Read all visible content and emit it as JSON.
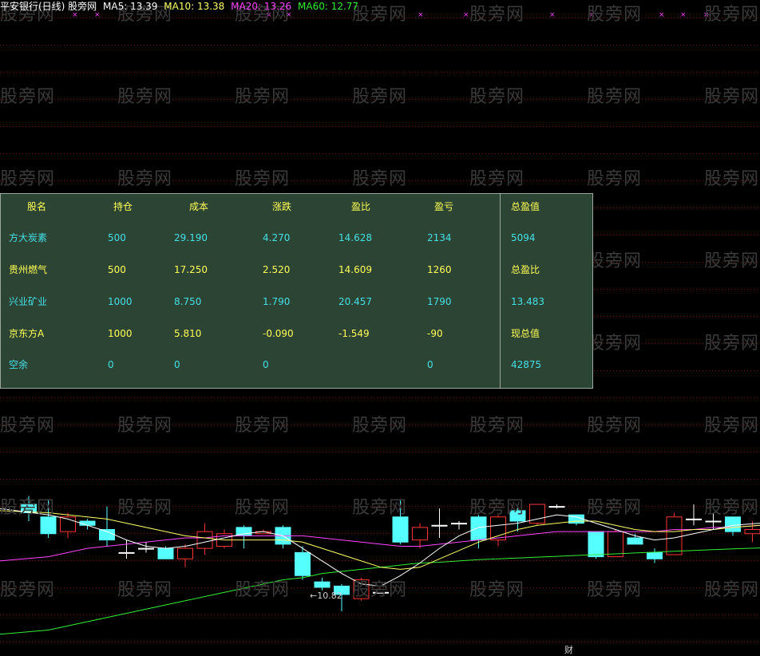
{
  "header": {
    "name": "平安银行(日线) 股旁网",
    "ma5": "MA5: 13.39",
    "ma10": "MA10: 13.38",
    "ma20": "MA20: 13.26",
    "ma60": "MA60: 12.77",
    "colors": {
      "name": "#ffffff",
      "ma5": "#ffffff",
      "ma10": "#ffff66",
      "ma20": "#ff44ff",
      "ma60": "#33ee33"
    }
  },
  "watermark": "股旁网",
  "table": {
    "headers": [
      "股名",
      "持仓",
      "成本",
      "涨跌",
      "盈比",
      "盈亏"
    ],
    "rows": [
      {
        "name": "方大炭素",
        "position": "500",
        "cost": "29.190",
        "change": "4.270",
        "ratio": "14.628",
        "pnl": "2134",
        "color": "#44e0e6"
      },
      {
        "name": "贵州燃气",
        "position": "500",
        "cost": "17.250",
        "change": "2.520",
        "ratio": "14.609",
        "pnl": "1260",
        "color": "#ffff55"
      },
      {
        "name": "兴业矿业",
        "position": "1000",
        "cost": "8.750",
        "change": "1.790",
        "ratio": "20.457",
        "pnl": "1790",
        "color": "#44e0e6"
      },
      {
        "name": "京东方A",
        "position": "1000",
        "cost": "5.810",
        "change": "-0.090",
        "ratio": "-1.549",
        "pnl": "-90",
        "color": "#ffff55"
      },
      {
        "name": "空余",
        "position": "0",
        "cost": "0",
        "change": "0",
        "ratio": "",
        "pnl": "0",
        "color": "#44e0e6"
      }
    ],
    "summary": [
      {
        "text": "总盈值",
        "color": "#ffff55"
      },
      {
        "text": "5094",
        "color": "#44e0e6"
      },
      {
        "text": "总盈比",
        "color": "#ffff55"
      },
      {
        "text": "13.483",
        "color": "#44e0e6"
      },
      {
        "text": "现总值",
        "color": "#ffff55"
      },
      {
        "text": "42875",
        "color": "#44e0e6"
      }
    ],
    "header_color": "#ffff55"
  },
  "chart_data": {
    "type": "candlestick",
    "title": "平安银行(日线)",
    "low_label": "10.82",
    "bottom_label": "财",
    "ylim": [
      10.4,
      14.4
    ],
    "up_color": "#ff3333",
    "down_color": "#55ffff",
    "ma_colors": {
      "ma5": "#ffffff",
      "ma10": "#ffff66",
      "ma20": "#ff44ff",
      "ma60": "#33ee33"
    },
    "candles": [
      [
        13.6,
        13.4,
        13.8,
        13.2
      ],
      [
        13.3,
        12.9,
        13.7,
        12.8
      ],
      [
        12.95,
        13.3,
        13.4,
        12.8
      ],
      [
        13.2,
        13.1,
        13.25,
        13.0
      ],
      [
        13.0,
        12.75,
        13.55,
        12.6
      ],
      [
        12.45,
        12.45,
        12.75,
        12.3
      ],
      [
        12.55,
        12.55,
        12.7,
        12.45
      ],
      [
        12.55,
        12.3,
        12.6,
        12.3
      ],
      [
        12.3,
        12.55,
        12.65,
        12.1
      ],
      [
        12.55,
        12.95,
        13.15,
        12.4
      ],
      [
        12.6,
        12.9,
        13.0,
        12.55
      ],
      [
        13.05,
        12.85,
        13.1,
        12.55
      ],
      [
        12.9,
        12.95,
        13.0,
        12.9
      ],
      [
        13.05,
        12.65,
        13.1,
        12.55
      ],
      [
        12.45,
        11.9,
        12.6,
        11.8
      ],
      [
        11.75,
        11.62,
        11.85,
        11.55
      ],
      [
        11.65,
        11.45,
        11.7,
        11.05
      ],
      [
        11.35,
        11.8,
        11.85,
        11.3
      ],
      [
        11.5,
        11.5,
        11.5,
        11.5
      ],
      [
        13.3,
        12.7,
        13.7,
        12.65
      ],
      [
        12.75,
        13.05,
        13.15,
        12.55
      ],
      [
        13.1,
        13.1,
        13.5,
        12.8
      ],
      [
        13.15,
        13.15,
        13.2,
        13.0
      ],
      [
        13.3,
        12.75,
        13.35,
        12.55
      ],
      [
        12.75,
        13.3,
        13.35,
        12.6
      ],
      [
        13.45,
        13.2,
        13.55,
        12.95
      ],
      [
        13.15,
        13.6,
        13.6,
        13.1
      ],
      [
        13.55,
        13.55,
        13.6,
        13.5
      ],
      [
        13.35,
        13.15,
        13.35,
        13.1
      ],
      [
        12.95,
        12.35,
        12.95,
        12.3
      ],
      [
        12.35,
        12.95,
        13.0,
        12.35
      ],
      [
        12.8,
        12.65,
        12.9,
        12.65
      ],
      [
        12.45,
        12.3,
        12.55,
        12.2
      ],
      [
        12.4,
        13.3,
        13.4,
        12.4
      ],
      [
        13.25,
        13.25,
        13.6,
        13.1
      ],
      [
        13.2,
        13.2,
        13.4,
        13.0
      ],
      [
        13.3,
        12.95,
        13.3,
        12.85
      ],
      [
        12.9,
        13.0,
        13.2,
        12.7
      ]
    ],
    "ma5": [
      13.5,
      13.35,
      13.25,
      13.1,
      12.95,
      12.75,
      12.6,
      12.55,
      12.6,
      12.7,
      12.8,
      12.9,
      12.95,
      12.85,
      12.55,
      12.25,
      11.95,
      11.7,
      11.65,
      11.9,
      12.2,
      12.55,
      12.85,
      13.05,
      13.1,
      13.15,
      13.25,
      13.35,
      13.3,
      13.15,
      13.0,
      12.85,
      12.75,
      12.8,
      12.9,
      13.0,
      13.1,
      13.15
    ],
    "ma10": [
      13.45,
      13.4,
      13.35,
      13.3,
      13.25,
      13.15,
      13.05,
      12.95,
      12.85,
      12.8,
      12.75,
      12.75,
      12.75,
      12.75,
      12.7,
      12.55,
      12.4,
      12.25,
      12.1,
      12.05,
      12.1,
      12.3,
      12.5,
      12.7,
      12.85,
      13.0,
      13.1,
      13.15,
      13.2,
      13.2,
      13.1,
      13.0,
      12.95,
      12.95,
      13.0,
      13.0,
      13.05,
      13.1
    ],
    "ma20": [
      12.25,
      12.35,
      12.45,
      12.55,
      12.6,
      12.65,
      12.7,
      12.75,
      12.8,
      12.8,
      12.85,
      12.85,
      12.85,
      12.85,
      12.85,
      12.8,
      12.75,
      12.7,
      12.65,
      12.6,
      12.6,
      12.65,
      12.7,
      12.75,
      12.8,
      12.85,
      12.9,
      12.95,
      12.95,
      12.95,
      12.95,
      12.95,
      12.95,
      13.0,
      13.0,
      13.05,
      13.05,
      13.1
    ],
    "ma60": [
      10.5,
      10.6,
      10.7,
      10.8,
      10.9,
      11.0,
      11.1,
      11.2,
      11.3,
      11.4,
      11.5,
      11.6,
      11.7,
      11.8,
      11.85,
      11.95,
      12.0,
      12.05,
      12.1,
      12.15,
      12.2,
      12.22,
      12.25,
      12.28,
      12.3,
      12.32,
      12.34,
      12.36,
      12.38,
      12.4,
      12.42,
      12.44,
      12.46,
      12.48,
      12.5,
      12.52,
      12.54,
      12.56
    ]
  }
}
